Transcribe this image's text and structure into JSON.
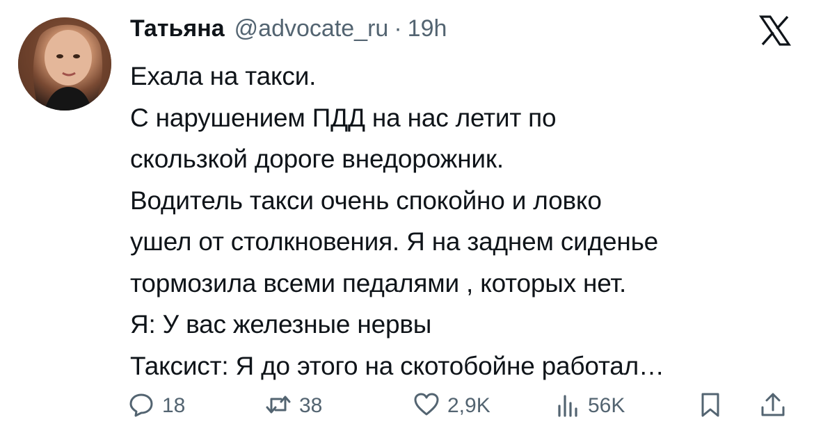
{
  "tweet": {
    "author": {
      "display_name": "Татьяна",
      "handle": "@advocate_ru",
      "separator": "·",
      "time": "19h"
    },
    "lines": [
      "Ехала на такси.",
      "С нарушением ПДД на нас летит по",
      "скользкой дороге внедорожник.",
      "Водитель такси очень спокойно и ловко",
      "ушел от столкновения. Я на заднем сиденье",
      "тормозила всеми педалями , которых нет.",
      "Я:  У вас железные нервы",
      "Таксист:  Я до этого на скотобойне работал…"
    ],
    "actions": {
      "replies": "18",
      "reposts": "38",
      "likes": "2,9K",
      "views": "56K"
    }
  },
  "icons": {
    "logo": "x-logo-icon",
    "reply": "reply-icon",
    "repost": "repost-icon",
    "like": "heart-icon",
    "views": "views-chart-icon",
    "bookmark": "bookmark-icon",
    "share": "share-icon"
  },
  "colors": {
    "text": "#0f1419",
    "secondary": "#536471"
  }
}
